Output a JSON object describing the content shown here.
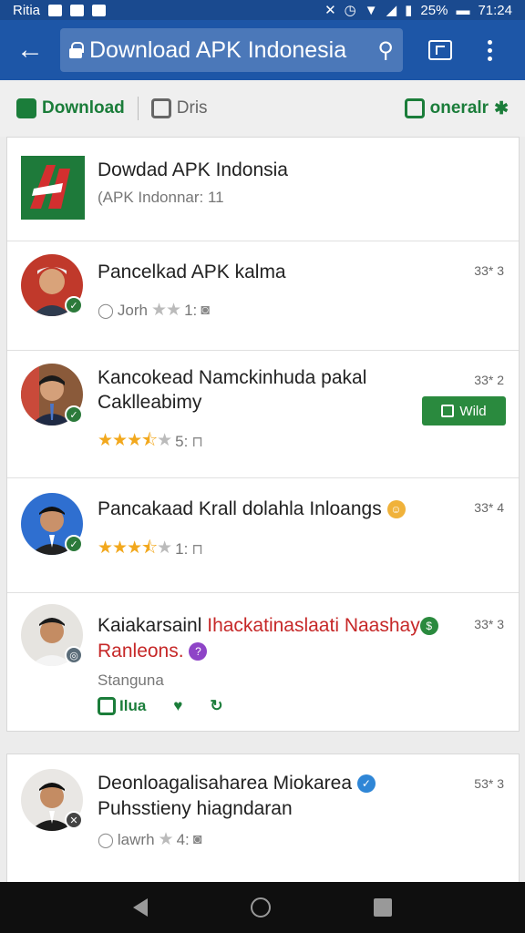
{
  "status_bar": {
    "left_text": "Ritia",
    "battery": "25%",
    "time": "71:24"
  },
  "app_bar": {
    "search_text": "Download APK Indonesia"
  },
  "filters": {
    "download": "Download",
    "dris": "Dris",
    "onerair": "oneralr"
  },
  "listing": {
    "header": {
      "title": "Dowdad APK Indonsia",
      "subtitle": "(APK Indonnar: 11"
    },
    "items": [
      {
        "title": "Pancelkad APK kalma",
        "meta_user": "Jorh",
        "meta_num": "1:",
        "count": "33* 3",
        "rating": 0
      },
      {
        "title_line1": "Kancokead Namckinhuda pakal",
        "title_line2": "Caklleabimy",
        "meta_num": "5:",
        "count": "33* 2",
        "rating": 3.5,
        "install_label": "Wild"
      },
      {
        "title": "Pancakaad Krall dolahla Inloangs",
        "meta_num": "1:",
        "count": "33* 4",
        "rating": 3.5
      },
      {
        "title_part1": "Kaiakarsainl ",
        "title_part2_red": "Ihackatinaslaati Naashay",
        "title_line2_red": "Ranleons.",
        "subline": "Stanguna",
        "count": "33* 3",
        "action1": "Ilua"
      }
    ]
  },
  "second_card": {
    "item": {
      "title_line1": "Deonloagalisaharea Miokarea",
      "title_line2": "Puhsstieny hiagndaran",
      "meta_user": "lawrh",
      "meta_num": "4:",
      "count": "53* 3"
    }
  },
  "colors": {
    "app_bar": "#1d56a7",
    "green": "#2a8a3e",
    "star": "#f2a81d"
  }
}
